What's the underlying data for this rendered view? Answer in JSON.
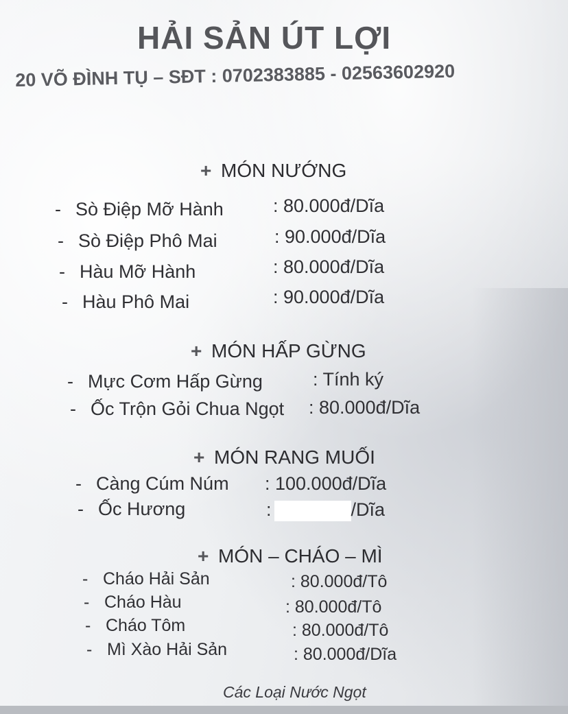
{
  "header": {
    "title": "HẢI SẢN ÚT LỢI",
    "address_line": "20 VÕ ĐÌNH TỤ – SĐT : 0702383885  -  02563602920"
  },
  "sections": [
    {
      "title": "MÓN NƯỚNG",
      "items": [
        {
          "name": "Sò Điệp Mỡ Hành",
          "price": ": 80.000đ/Dĩa"
        },
        {
          "name": "Sò Điệp Phô Mai",
          "price": ": 90.000đ/Dĩa"
        },
        {
          "name": "Hàu Mỡ Hành",
          "price": ": 80.000đ/Dĩa"
        },
        {
          "name": "Hàu Phô Mai",
          "price": ": 90.000đ/Dĩa"
        }
      ]
    },
    {
      "title": "MÓN HẤP GỪNG",
      "items": [
        {
          "name": "Mực Cơm Hấp Gừng",
          "price": ": Tính ký"
        },
        {
          "name": "Ốc Trộn Gỏi Chua Ngọt",
          "price": ": 80.000đ/Dĩa"
        }
      ]
    },
    {
      "title": "MÓN RANG MUỐI",
      "items": [
        {
          "name": "Càng Cúm Núm",
          "price": ": 100.000đ/Dĩa"
        },
        {
          "name": "Ốc Hương",
          "price_prefix": ":",
          "price_suffix": "/Dĩa"
        }
      ]
    },
    {
      "title": "MÓN – CHÁO – MÌ",
      "items": [
        {
          "name": "Cháo Hải Sản",
          "price": ": 80.000đ/Tô"
        },
        {
          "name": "Cháo Hàu",
          "price": ": 80.000đ/Tô"
        },
        {
          "name": "Cháo Tôm",
          "price": ": 80.000đ/Tô"
        },
        {
          "name": "Mì Xào Hải Sản",
          "price": ": 80.000đ/Dĩa"
        }
      ]
    }
  ],
  "footer": "Các Loại Nước Ngọt",
  "symbols": {
    "bullet": "-",
    "section_mark": "+"
  }
}
